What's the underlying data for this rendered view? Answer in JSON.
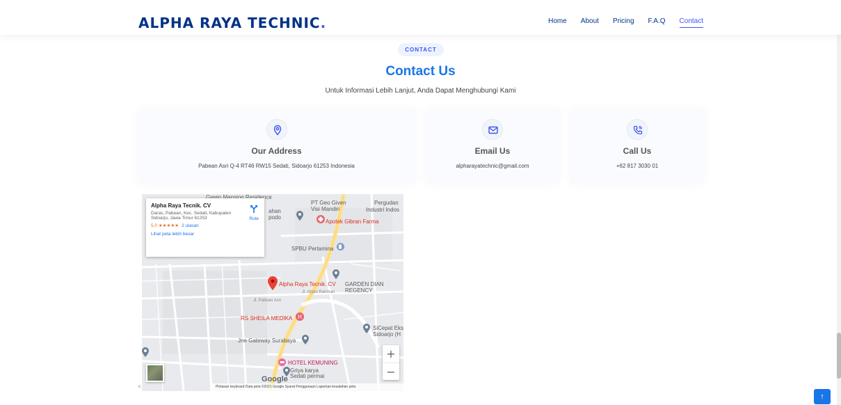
{
  "header": {
    "logo_text": "ALPHA RAYA TECHNIC",
    "logo_dot": ".",
    "nav": [
      {
        "label": "Home"
      },
      {
        "label": "About"
      },
      {
        "label": "Pricing"
      },
      {
        "label": "F.A.Q"
      },
      {
        "label": "Contact",
        "active": true
      }
    ]
  },
  "section": {
    "badge": "CONTACT",
    "title": "Contact Us",
    "subtitle": "Untuk Informasi Lebih Lanjut, Anda Dapat Menghubungi Kami"
  },
  "cards": {
    "address": {
      "icon": "location-pin-icon",
      "title": "Our Address",
      "text": "Pabean Asri Q-4 RT46 RW15 Sedati, Sidoarjo 61253 Indonesia"
    },
    "email": {
      "icon": "envelope-icon",
      "title": "Email Us",
      "text": "alpharayatechnic@gmail.com"
    },
    "phone": {
      "icon": "phone-icon",
      "title": "Call Us",
      "text": "+62 817 3030 01"
    }
  },
  "map": {
    "info_title": "Alpha Raya Tecnik. CV",
    "info_address": "Daras, Pabean, Kec. Sedati, Kabupaten Sidoarjo, Jawa Timur 61253",
    "rating": "5,0 ★★★★★",
    "reviews": "2 ulasan",
    "bigger_map_link": "Lihat peta lebih besar",
    "route_label": "Rute",
    "labels": {
      "green_mansion": "Green Mansion Residence",
      "pt_geo": "PT Geo Given",
      "visi_mandiri": "Visi Mandiri",
      "pergudangan": "Pergudan",
      "industri": "Industri Indos",
      "bahan": "ahan",
      "podo": "podo",
      "apotek": "Apotek Gibran Farma",
      "spbu": "SPBU Pertamina",
      "alpha_pin": "Alpha Raya Tecnik. CV",
      "garden_dian": "GARDEN DIAN",
      "regency": "REGENCY",
      "rs_sheila": "RS SHEILA MEDIKA",
      "sicepat": "SiCepat Eks",
      "sicepat2": "Sidoarjo (H",
      "jne": "Jne Gateway Surabaya",
      "hotel": "HOTEL KEMUNING",
      "griya": "Griya karya",
      "griya2": "Sedati permai",
      "street_pabean": "Jl. Pabean Asri",
      "street_abdul": "Jl. Abdul Rahman"
    },
    "zoom_in": "+",
    "zoom_out": "−",
    "google": "Google",
    "footer_text": "Pintasan keyboard   Data peta ©2021 Google   Syarat Penggunaan   Laporkan kesalahan peta",
    "left_arrow": "<"
  },
  "back_to_top": "↑",
  "colors": {
    "brand": "#013289",
    "accent": "#4154f1",
    "title_blue": "#1a75e8",
    "pin_red": "#d93025"
  }
}
